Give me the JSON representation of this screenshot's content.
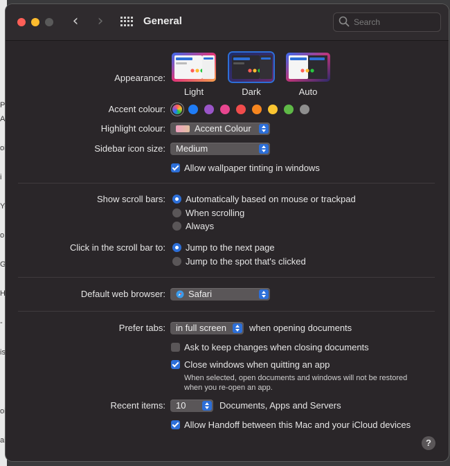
{
  "window": {
    "title": "General"
  },
  "search": {
    "placeholder": "Search"
  },
  "appearance": {
    "label": "Appearance:",
    "options": [
      {
        "label": "Light",
        "selected": false
      },
      {
        "label": "Dark",
        "selected": true
      },
      {
        "label": "Auto",
        "selected": false
      }
    ]
  },
  "accent": {
    "label": "Accent colour:",
    "colors": [
      "multicolor",
      "#1f7cf6",
      "#9a55c8",
      "#e8468f",
      "#f14c4c",
      "#f6861f",
      "#fbc531",
      "#5fb947",
      "#8e8e8e"
    ]
  },
  "highlight": {
    "label": "Highlight colour:",
    "value": "Accent Colour"
  },
  "sidebar_icon": {
    "label": "Sidebar icon size:",
    "value": "Medium"
  },
  "wallpaper_tint": {
    "label": "Allow wallpaper tinting in windows",
    "checked": true
  },
  "scrollbars": {
    "label": "Show scroll bars:",
    "options": [
      {
        "label": "Automatically based on mouse or trackpad",
        "selected": true
      },
      {
        "label": "When scrolling",
        "selected": false
      },
      {
        "label": "Always",
        "selected": false
      }
    ]
  },
  "click_scroll": {
    "label": "Click in the scroll bar to:",
    "options": [
      {
        "label": "Jump to the next page",
        "selected": true
      },
      {
        "label": "Jump to the spot that's clicked",
        "selected": false
      }
    ]
  },
  "browser": {
    "label": "Default web browser:",
    "value": "Safari"
  },
  "tabs": {
    "label": "Prefer tabs:",
    "value": "in full screen",
    "suffix": "when opening documents"
  },
  "ask_keep": {
    "label": "Ask to keep changes when closing documents",
    "checked": false
  },
  "close_windows": {
    "label": "Close windows when quitting an app",
    "checked": true,
    "note_line1": "When selected, open documents and windows will not be restored",
    "note_line2": "when you re-open an app."
  },
  "recent": {
    "label": "Recent items:",
    "value": "10",
    "suffix": "Documents, Apps and Servers"
  },
  "handoff": {
    "label": "Allow Handoff between this Mac and your iCloud devices",
    "checked": true
  },
  "help": {
    "label": "?"
  },
  "background_strip": [
    "Pr",
    "A",
    "oi",
    "i",
    "Yo",
    "o",
    "G",
    "H",
    "-",
    "is",
    "oi",
    "ai"
  ],
  "colors": {
    "accent_blue": "#2d6fd8",
    "window_bg": "#2a2629"
  }
}
